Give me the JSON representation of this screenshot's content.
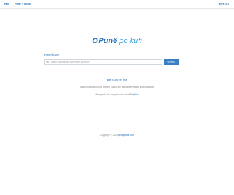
{
  "nav": {
    "home": "Hau",
    "link": "Punë e fundit",
    "signin": "Hyrë / Lo"
  },
  "logo": {
    "mark": "Punë",
    "rest": "po kufi"
  },
  "search": {
    "label": "Punë kupe",
    "placeholder": "psh. tregtar, magazinier, karpentier, financier",
    "button": "Kërko"
  },
  "stats": {
    "count": "409",
    "count_suffix": "punë të reja",
    "description": "Harmonizimi të punës, gjetja e punës dhe kandidatëve duke kufizuar largët",
    "lang_prefix": "Për punë dhe me përparim të në",
    "lang_link": "English"
  },
  "footer": {
    "copyright": "Copyright © 2025",
    "site": "punepokufi.com"
  },
  "colors": {
    "accent": "#2a6fb5",
    "button": "#3a7fc4",
    "logo_light": "#3aa1e0"
  }
}
